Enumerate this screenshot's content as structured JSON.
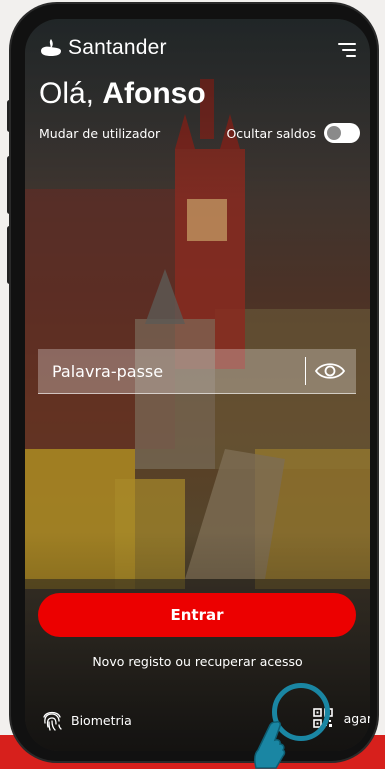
{
  "header": {
    "brand": "Santander",
    "logo_icon": "santander-flame-icon",
    "menu_icon": "menu-icon"
  },
  "greeting": {
    "prefix": "Olá, ",
    "name": "Afonso"
  },
  "switch_user": "Mudar de utilizador",
  "hide_balances": {
    "label": "Ocultar saldos",
    "enabled": false
  },
  "password": {
    "placeholder": "Palavra-passe",
    "value": ""
  },
  "enter_button": "Entrar",
  "register_link": "Novo registo ou recuperar acesso",
  "biometrics": {
    "label": "Biometria",
    "icon": "fingerprint-icon"
  },
  "pay": {
    "label": "agar",
    "icon": "qr-code-icon"
  },
  "colors": {
    "primary_red": "#ec0000",
    "highlight_ring": "#1a86a3"
  }
}
